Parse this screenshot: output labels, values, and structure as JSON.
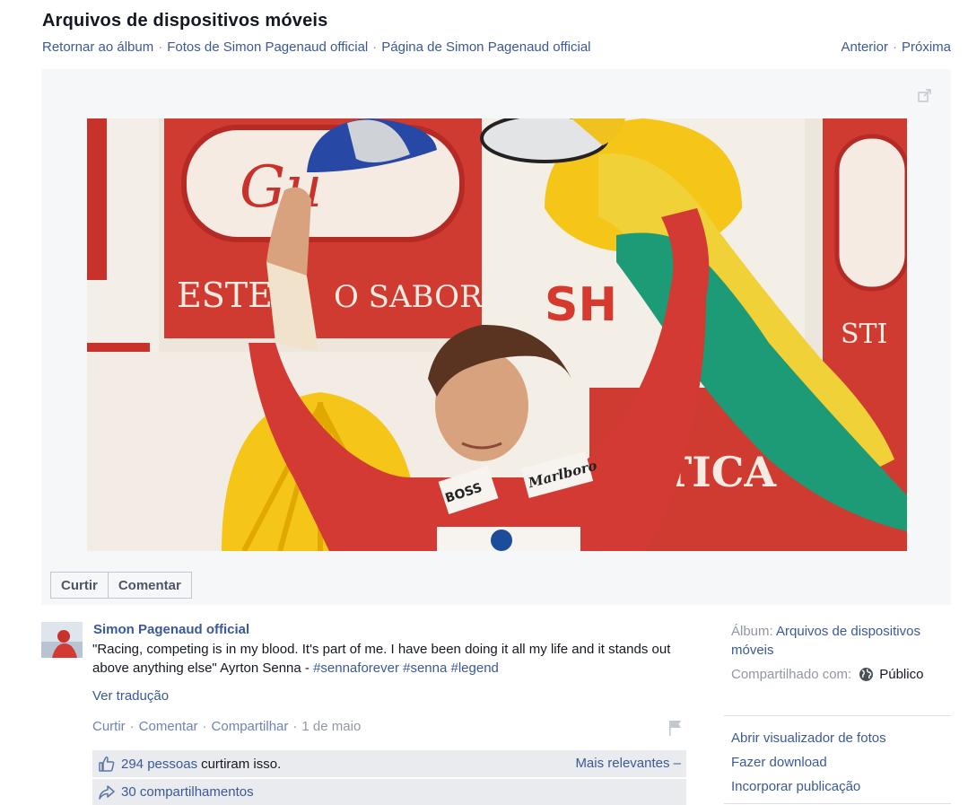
{
  "header": {
    "title": "Arquivos de dispositivos móveis",
    "breadcrumbs": [
      "Retornar ao álbum",
      "Fotos de Simon Pagenaud official",
      "Página de Simon Pagenaud official"
    ],
    "pager": {
      "prev": "Anterior",
      "next": "Próxima"
    }
  },
  "photo": {
    "banner_texts": [
      "Gu",
      "ESTE",
      "O SABOR",
      "SH",
      "STI",
      "TICA"
    ],
    "sponsor_patches": [
      "BOSS",
      "Marlboro"
    ]
  },
  "actions": {
    "like": "Curtir",
    "comment": "Comentar"
  },
  "post": {
    "author": "Simon Pagenaud official",
    "quote": "\"Racing, competing is in my blood. It's part of me. I have been doing it all my life and it stands out above anything else\" Ayrton Senna -",
    "hashtags": "#sennaforever #senna #legend",
    "translate": "Ver tradução",
    "meta": {
      "like": "Curtir",
      "comment": "Comentar",
      "share": "Compartilhar",
      "date": "1 de maio"
    },
    "likes": {
      "count": "294 pessoas",
      "text": "curtiram isso.",
      "sort": "Mais relevantes –"
    },
    "shares": "30 compartilhamentos"
  },
  "sidebar": {
    "album_label": "Álbum:",
    "album_name": "Arquivos de dispositivos móveis",
    "shared_label": "Compartilhado com:",
    "shared_value": "Público",
    "links": [
      "Abrir visualizador de fotos",
      "Fazer download",
      "Incorporar publicação"
    ]
  },
  "icons": {
    "expand": "expand-icon",
    "flag": "flag-icon",
    "thumb": "thumbs-up-icon",
    "share": "share-arrow-icon",
    "globe": "globe-icon"
  },
  "colors": {
    "link": "#3b5998",
    "muted": "#9197a3",
    "stage_bg": "#f6f7f9",
    "bar_bg": "#e9ebee"
  }
}
